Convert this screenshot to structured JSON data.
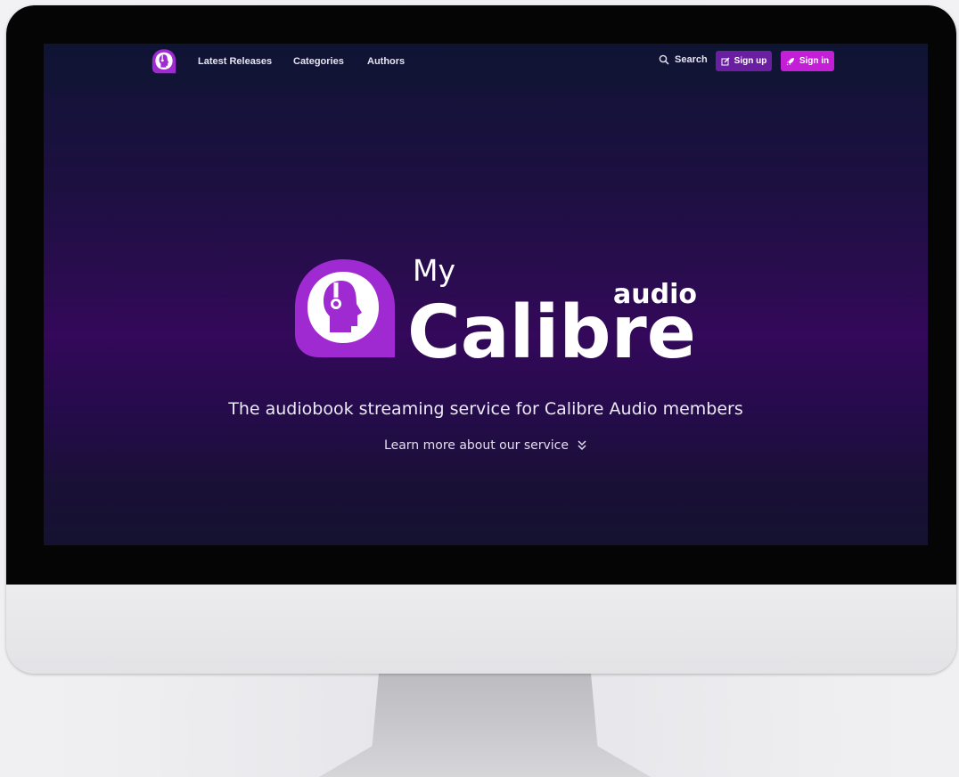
{
  "nav": {
    "links": [
      "Latest Releases",
      "Categories",
      "Authors"
    ],
    "search_label": "Search",
    "signup_label": "Sign up",
    "signin_label": "Sign in"
  },
  "hero": {
    "logo_my": "My",
    "logo_audio": "audio",
    "logo_calibre": "Calibre",
    "tagline": "The audiobook streaming service for Calibre Audio members",
    "learn_more": "Learn more about our service"
  },
  "icons": {
    "brand": "calibre-head-headphones-icon",
    "search": "search-icon",
    "signup": "edit-icon",
    "signin": "rocket-icon",
    "learn_more": "double-chevron-down-icon"
  },
  "colors": {
    "brand_purple": "#a02ad2",
    "signup_button": "#6a1fa0",
    "signin_button": "#c21fd6",
    "hero_bg": "#2b0c50"
  }
}
